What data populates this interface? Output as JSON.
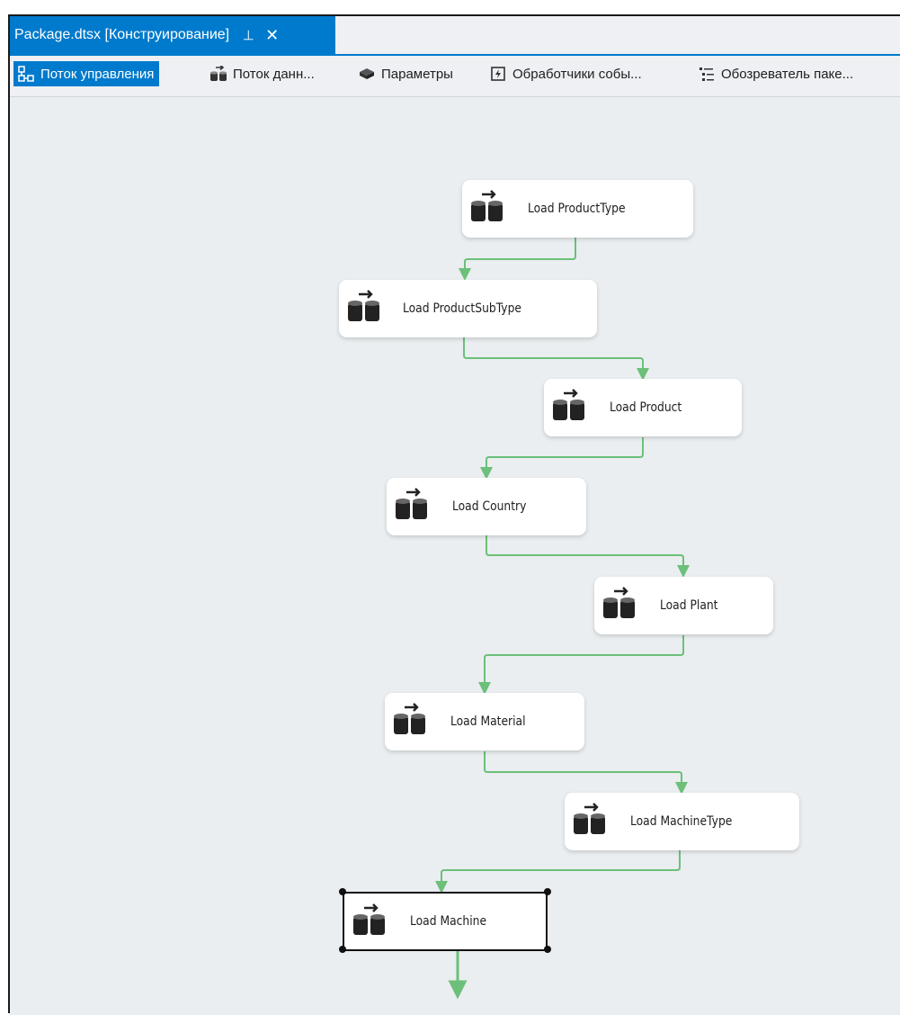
{
  "document_tab": {
    "title": "Package.dtsx [Конструирование]",
    "pin_glyph": "⊣",
    "close_glyph": "✕"
  },
  "designer_tabs": [
    {
      "label": "Поток управления",
      "icon": "control-flow-icon",
      "active": true
    },
    {
      "label": "Поток данн...",
      "icon": "data-flow-icon",
      "active": false
    },
    {
      "label": "Параметры",
      "icon": "parameters-icon",
      "active": false
    },
    {
      "label": "Обработчики собы...",
      "icon": "event-handlers-icon",
      "active": false
    },
    {
      "label": "Обозреватель паке...",
      "icon": "package-explorer-icon",
      "active": false
    }
  ],
  "tasks": [
    {
      "label": "Load ProductType"
    },
    {
      "label": "Load ProductSubType"
    },
    {
      "label": "Load Product"
    },
    {
      "label": "Load Country"
    },
    {
      "label": "Load Plant"
    },
    {
      "label": "Load Material"
    },
    {
      "label": "Load MachineType"
    },
    {
      "label": "Load Machine",
      "selected": true
    }
  ],
  "colors": {
    "accent": "#007acc",
    "canvas": "#eaeef0",
    "connector": "#6cc07a"
  }
}
